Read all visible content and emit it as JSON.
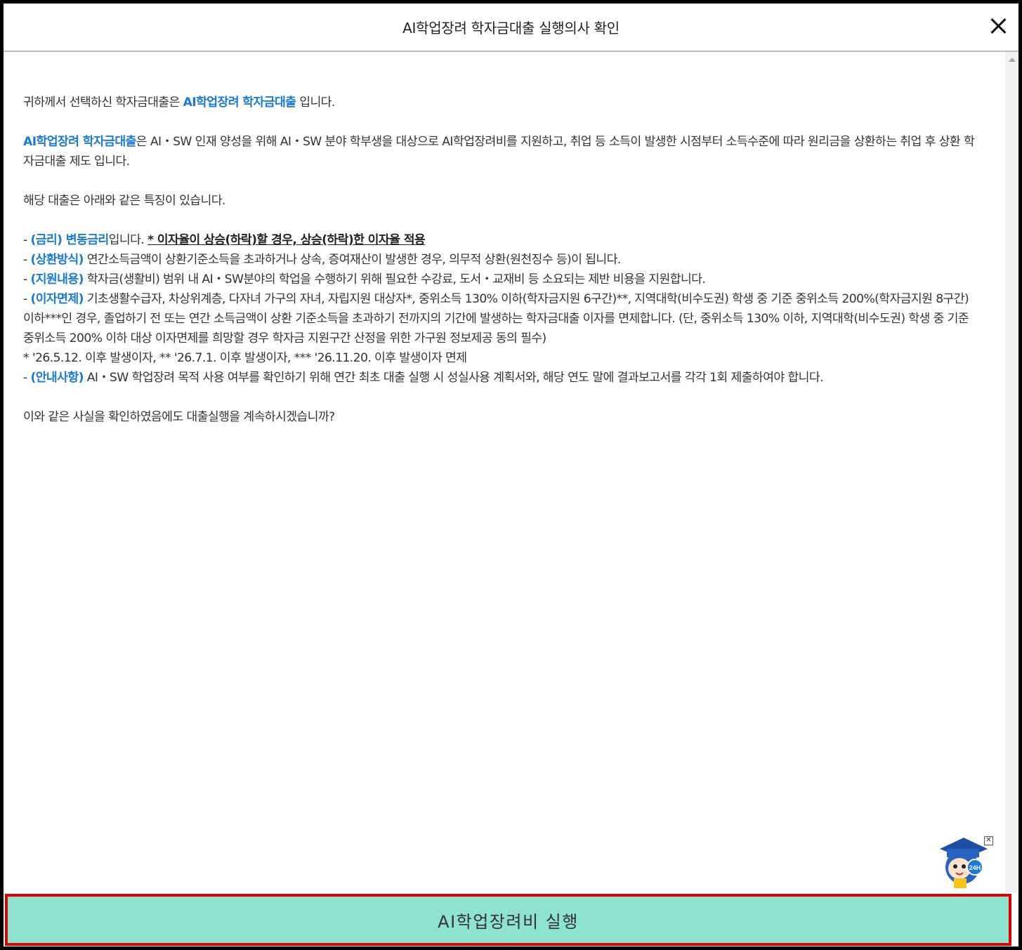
{
  "dialog": {
    "title": "AI학업장려 학자금대출 실행의사 확인",
    "close_label": "닫기"
  },
  "content": {
    "intro": {
      "prefix": "귀하께서 선택하신 학자금대출은 ",
      "highlight": "AI학업장려 학자금대출",
      "suffix": " 입니다."
    },
    "description": {
      "highlight": "AI학업장려 학자금대출",
      "text": "은 AI・SW 인재 양성을 위해 AI・SW 분야 학부생을 대상으로 AI학업장려비를 지원하고, 취업 등 소득이 발생한 시점부터 소득수준에 따라 원리금을 상환하는 취업 후 상환 학자금대출 제도 입니다."
    },
    "features_intro": "해당 대출은 아래와 같은 특징이 있습니다.",
    "features": [
      {
        "dash": "- ",
        "label": "(금리) 변동금리",
        "text": "입니다. ",
        "underline": "* 이자율이 상승(하락)할 경우, 상승(하락)한 이자율 적용"
      },
      {
        "dash": "- ",
        "label": "(상환방식)",
        "text": " 연간소득금액이 상환기준소득을 초과하거나 상속, 증여재산이 발생한 경우, 의무적 상환(원천징수 등)이 됩니다."
      },
      {
        "dash": "- ",
        "label": "(지원내용)",
        "text": " 학자금(생활비) 범위 내 AI・SW분야의 학업을 수행하기 위해 필요한 수강료, 도서・교재비 등 소요되는 제반 비용을 지원합니다."
      },
      {
        "dash": "- ",
        "label": "(이자면제)",
        "text": " 기초생활수급자, 차상위계층, 다자녀 가구의 자녀, 자립지원 대상자*, 중위소득 130% 이하(학자금지원 6구간)**, 지역대학(비수도권) 학생 중 기준 중위소득 200%(학자금지원 8구간) 이하***인 경우, 졸업하기 전 또는 연간 소득금액이 상환 기준소득을 초과하기 전까지의 기간에 발생하는 학자금대출 이자를 면제합니다. (단, 중위소득 130% 이하, 지역대학(비수도권) 학생 중 기준 중위소득 200% 이하 대상 이자면제를 희망할 경우 학자금 지원구간 산정을 위한 가구원 정보제공 동의 필수)"
      }
    ],
    "footnote": "* '26.5.12. 이후 발생이자, ** '26.7.1. 이후 발생이자, *** '26.11.20. 이후 발생이자 면제",
    "guide": {
      "dash": "- ",
      "label": "(안내사항)",
      "text": " AI・SW 학업장려 목적 사용 여부를 확인하기 위해 연간 최초 대출 실행 시 성실사용 계획서와, 해당 연도 말에 결과보고서를 각각 1회 제출하여야 합니다."
    },
    "question": "이와 같은 사실을 확인하였음에도 대출실행을 계속하시겠습니까?"
  },
  "mascot": {
    "badge": "24H",
    "close_symbol": "✕"
  },
  "action": {
    "execute_label": "AI학업장려비 실행"
  }
}
